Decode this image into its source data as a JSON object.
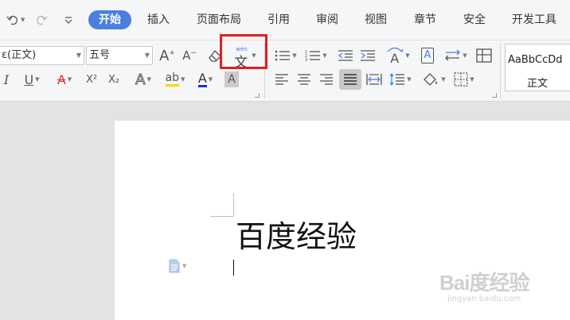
{
  "quick_access": {
    "undo_icon": "undo-icon",
    "redo_icon": "redo-icon",
    "customize_icon": "customize-icon"
  },
  "tabs": [
    {
      "label": "开始",
      "active": true
    },
    {
      "label": "插入"
    },
    {
      "label": "页面布局"
    },
    {
      "label": "引用"
    },
    {
      "label": "审阅"
    },
    {
      "label": "视图"
    },
    {
      "label": "章节"
    },
    {
      "label": "安全"
    },
    {
      "label": "开发工具"
    }
  ],
  "ribbon": {
    "font_name": "(正文)",
    "font_name_prefix": "ε",
    "font_size": "五号",
    "phonetic_label": "wén",
    "phonetic_char": "文",
    "bold_label": "I",
    "highlight_label": "ab",
    "font_color_label": "A",
    "char_shading_label": "A",
    "text_effect_label": "A",
    "clear_label": "A",
    "grow_label": "A",
    "shrink_label": "A",
    "text_direction_label": "A",
    "char_scale_label": "A",
    "superscript_label": "X²",
    "subscript_label": "X₂",
    "colors": {
      "highlight": "#f5d90a",
      "font_color": "#1a2ee6",
      "accent": "#4a7fe0",
      "annotation": "#e41e1e"
    }
  },
  "styles": {
    "sample": "AaBbCcDd",
    "name": "正文"
  },
  "document": {
    "text": "百度经验"
  },
  "watermark": {
    "main": "Bai度经验",
    "sub": "jingyan.baidu.com"
  }
}
